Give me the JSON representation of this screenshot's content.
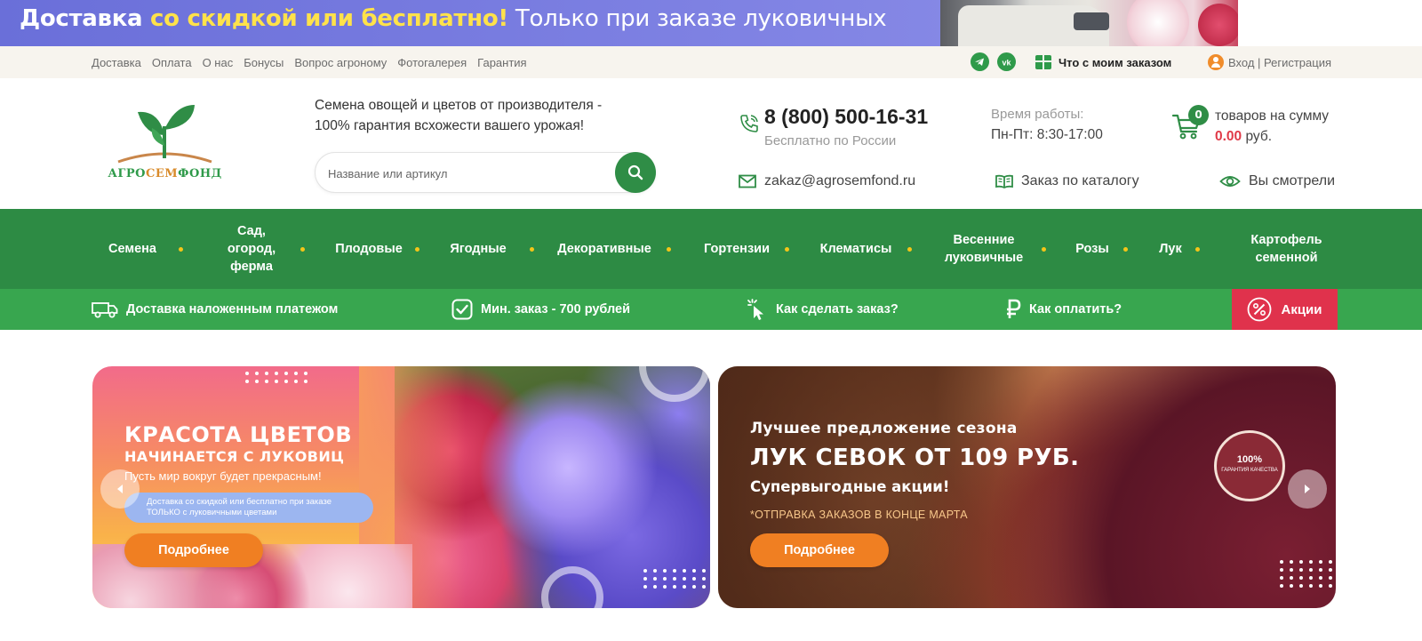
{
  "promo": {
    "part1": "Доставка ",
    "highlight": "со скидкой или бесплатно!",
    "part2": " Только при заказе луковичных"
  },
  "topbar": {
    "links": [
      "Доставка",
      "Оплата",
      "О нас",
      "Бонусы",
      "Вопрос агроному",
      "Фотогалерея",
      "Гарантия"
    ],
    "social": [
      "telegram-icon",
      "vk-icon"
    ],
    "order_status": "Что с моим заказом",
    "login": "Вход | Регистрация"
  },
  "header": {
    "logo": {
      "part1": "АГРО",
      "part2": "СЕМ",
      "part3": "ФОНД"
    },
    "tagline_line1": "Семена овощей и цветов от производителя -",
    "tagline_line2": "100% гарантия всхожести вашего урожая!",
    "search": {
      "placeholder": "Название или артикул"
    },
    "phone": "8 (800) 500-16-31",
    "phone_note": "Бесплатно по России",
    "hours_label": "Время работы:",
    "hours_value": "Пн-Пт: 8:30-17:00",
    "cart": {
      "count": "0",
      "label": "товаров на сумму",
      "sum": "0.00",
      "currency": " руб."
    },
    "email": "zakaz@agrosemfond.ru",
    "catalog_order": "Заказ по каталогу",
    "viewed": "Вы смотрели"
  },
  "main_nav": [
    "Семена",
    "Сад,\nогород,\nферма",
    "Плодовые",
    "Ягодные",
    "Декоративные",
    "Гортензии",
    "Клематисы",
    "Весенние\nлуковичные",
    "Розы",
    "Лук",
    "Картофель\nсеменной"
  ],
  "sub_nav": {
    "delivery": "Доставка наложенным платежом",
    "min_order": "Мин. заказ - 700 рублей",
    "how_to_order": "Как сделать заказ?",
    "how_to_pay": "Как оплатить?",
    "promotions": "Акции"
  },
  "banners": [
    {
      "title": "КРАСОТА ЦВЕТОВ",
      "subtitle": "НАЧИНАЕТСЯ С ЛУКОВИЦ",
      "desc": "Пусть мир вокруг будет прекрасным!",
      "pill_line1": "Доставка со скидкой или бесплатно при заказе",
      "pill_line2": "ТОЛЬКО с луковичными цветами",
      "button": "Подробнее"
    },
    {
      "line1": "Лучшее предложение сезона",
      "line2": "ЛУК СЕВОК ОТ 109 РУБ.",
      "line3": "Супервыгодные акции!",
      "line4": "*ОТПРАВКА ЗАКАЗОВ В КОНЦЕ МАРТА",
      "badge_top": "100%",
      "badge_text": "ГАРАНТИЯ КАЧЕСТВА",
      "button": "Подробнее"
    }
  ],
  "colors": {
    "green_dark": "#2d8b44",
    "green_light": "#38a64f",
    "accent_red": "#e0324c",
    "orange": "#f07f22",
    "promo_bg": "#6a6fd9",
    "highlight_yellow": "#ffe24a"
  }
}
